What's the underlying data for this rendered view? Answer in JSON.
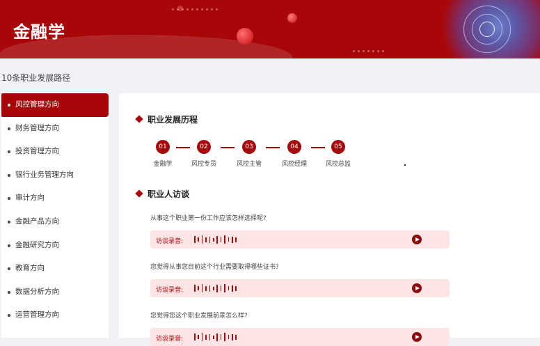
{
  "header": {
    "title": "金融学"
  },
  "subtitle": "10条职业发展路径",
  "sidebar": {
    "items": [
      {
        "label": "风控管理方向",
        "active": true
      },
      {
        "label": "财务管理方向"
      },
      {
        "label": "投资管理方向"
      },
      {
        "label": "银行业务管理方向"
      },
      {
        "label": "审计方向"
      },
      {
        "label": "金融产品方向"
      },
      {
        "label": "金融研究方向"
      },
      {
        "label": "教育方向"
      },
      {
        "label": "数据分析方向"
      },
      {
        "label": "运营管理方向"
      }
    ]
  },
  "career": {
    "title": "职业发展历程",
    "steps": [
      {
        "num": "01",
        "label": "金融学"
      },
      {
        "num": "02",
        "label": "风控专员"
      },
      {
        "num": "03",
        "label": "风控主管"
      },
      {
        "num": "04",
        "label": "风控经理"
      },
      {
        "num": "05",
        "label": "风控总监"
      }
    ]
  },
  "interview": {
    "title": "职业人访谈",
    "audio_label": "访谈录音:",
    "questions": [
      "从事这个职业第一份工作应该怎样选择呢?",
      "您觉得从事您目前这个行业需要取得哪些证书?",
      "您觉得您这个职业发展前景怎么样?"
    ]
  },
  "colors": {
    "brand": "#a8070a",
    "audio_bg": "#fde4e5",
    "page_bg": "#f1f2f6"
  },
  "icons": {
    "play": "play-icon",
    "diamond": "diamond-icon",
    "bullet": "bullet-icon"
  }
}
